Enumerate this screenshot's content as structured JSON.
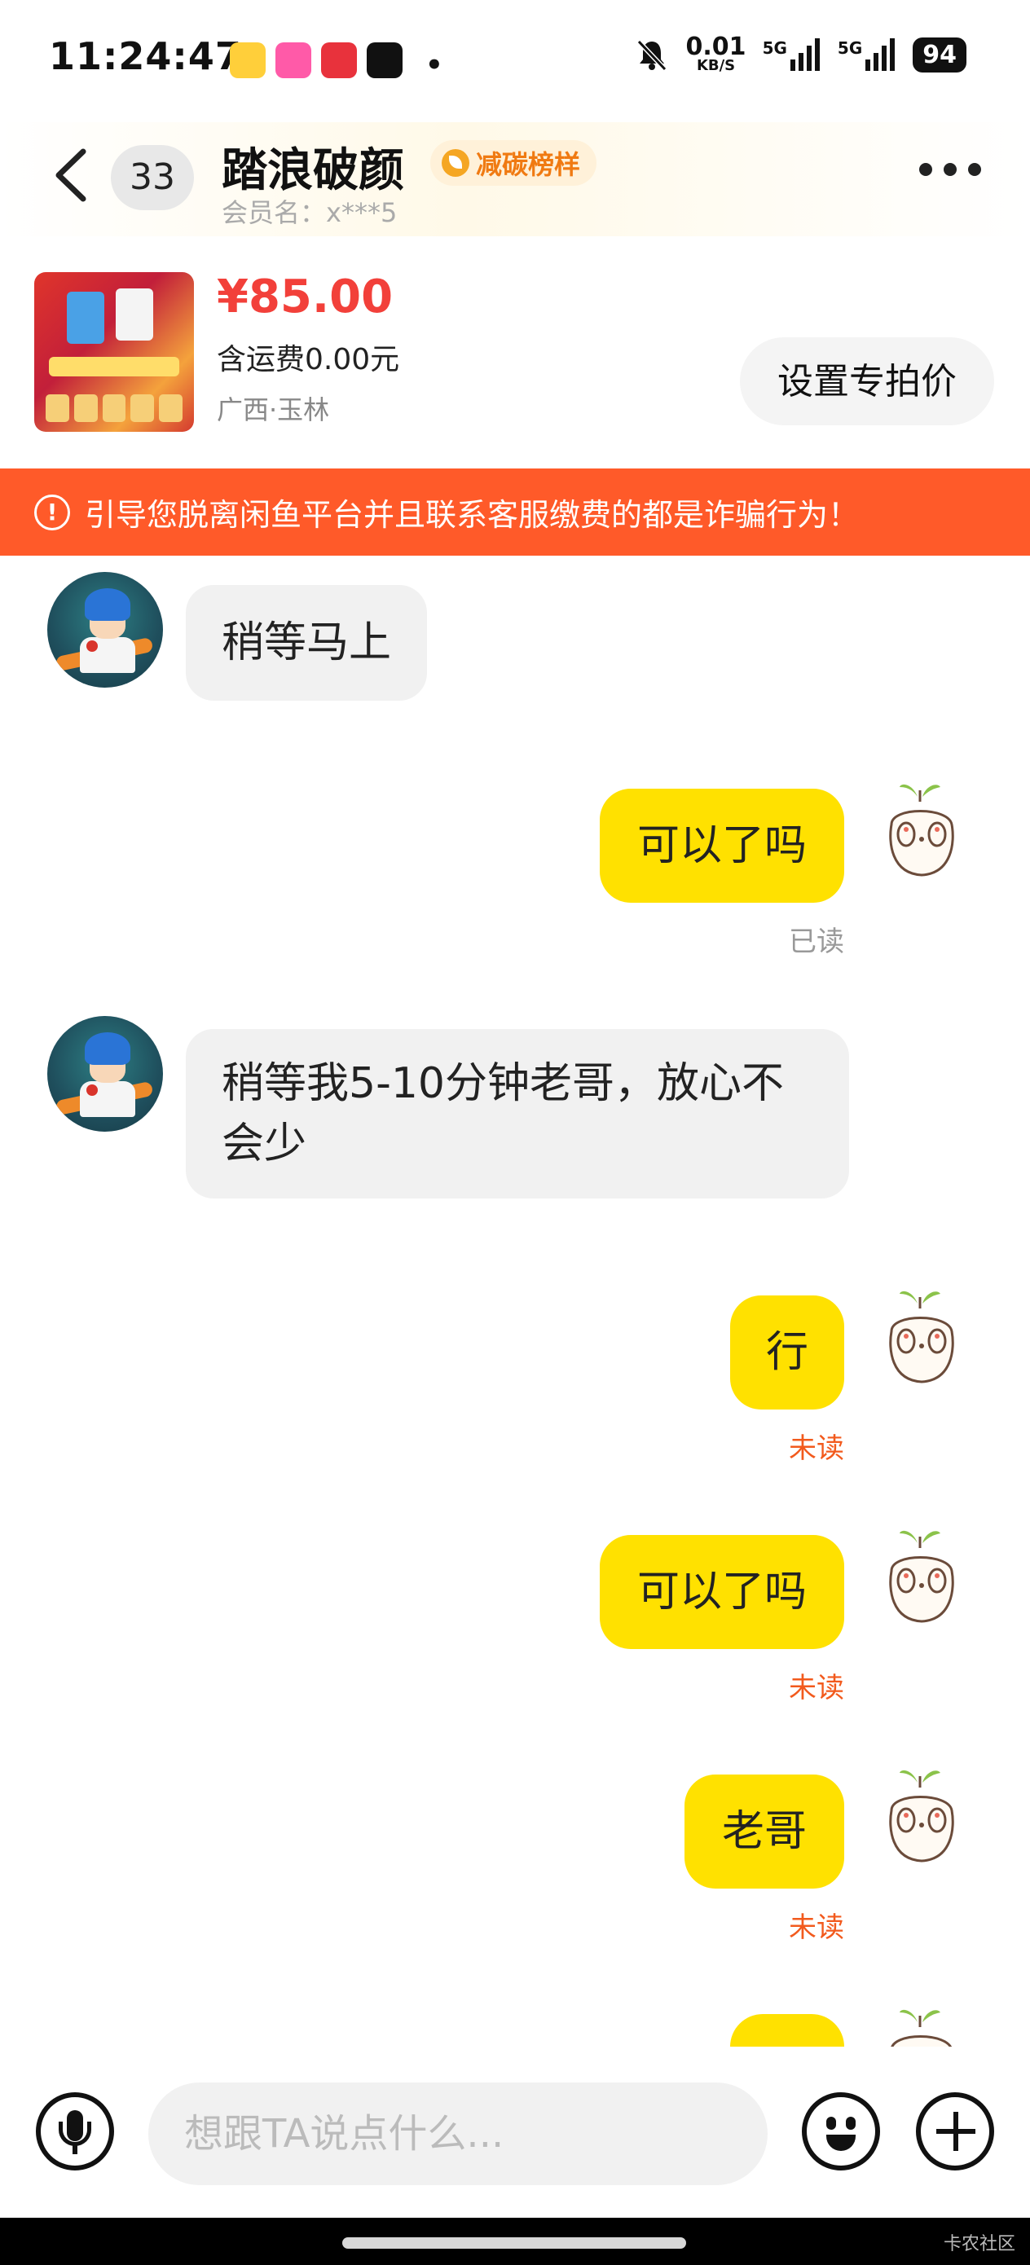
{
  "status_bar": {
    "time": "11:24:47",
    "dot": "•",
    "net_speed": "0.01",
    "net_unit": "KB/S",
    "signal1": "5G",
    "signal2": "5G",
    "battery": "94"
  },
  "header": {
    "unread_count": "33",
    "nickname": "踏浪破颜",
    "badge": "减碳榜样",
    "member_name": "会员名：x***5"
  },
  "product": {
    "price": "¥85.00",
    "shipping": "含运费0.00元",
    "location": "广西·玉林",
    "set_price_button": "设置专拍价"
  },
  "warning": {
    "icon": "!",
    "text": "引导您脱离闲鱼平台并且联系客服缴费的都是诈骗行为！"
  },
  "messages": [
    {
      "side": "left",
      "text": "稍等马上"
    },
    {
      "side": "right",
      "text": "可以了吗",
      "status": "已读"
    },
    {
      "side": "left",
      "text": "稍等我5-10分钟老哥，放心不会少"
    },
    {
      "side": "right",
      "text": "行",
      "status": "未读"
    },
    {
      "side": "right",
      "text": "可以了吗",
      "status": "未读"
    },
    {
      "side": "right",
      "text": "老哥",
      "status": "未读"
    }
  ],
  "input": {
    "placeholder": "想跟TA说点什么..."
  },
  "nav": {
    "watermark": "卡农社区"
  },
  "colors": {
    "accent_yellow": "#ffe100",
    "warning_orange": "#ff5a29",
    "price_red": "#f2403a",
    "unread_orange": "#f25a1d"
  }
}
